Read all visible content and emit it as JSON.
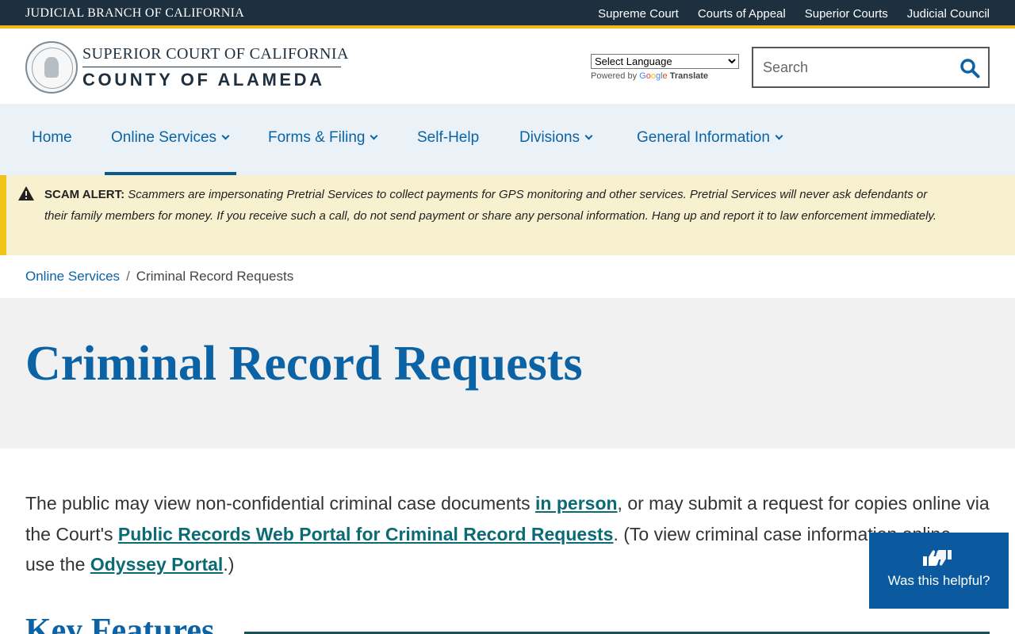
{
  "topbar": {
    "branch": "JUDICIAL BRANCH OF CALIFORNIA",
    "links": [
      "Supreme Court",
      "Courts of Appeal",
      "Superior Courts",
      "Judicial Council"
    ]
  },
  "header": {
    "court_line1": "SUPERIOR COURT OF CALIFORNIA",
    "court_line2": "COUNTY OF ALAMEDA",
    "language_select": "Select Language",
    "powered_by": "Powered by",
    "google": [
      "G",
      "o",
      "o",
      "g",
      "l",
      "e"
    ],
    "translate": "Translate",
    "search_placeholder": "Search"
  },
  "nav": {
    "items": [
      {
        "label": "Home"
      },
      {
        "label": "Online Services"
      },
      {
        "label": "Forms & Filing"
      },
      {
        "label": "Self-Help"
      },
      {
        "label": "Divisions"
      },
      {
        "label": "General Information"
      }
    ],
    "active": "Online Services"
  },
  "alert": {
    "label": "SCAM ALERT:",
    "text": "Scammers are impersonating Pretrial Services to collect payments for GPS monitoring and other services.  Pretrial Services will never ask defendants or their family members for money. If you receive such a call, do not send payment or share any personal information.  Hang up and report it to law enforcement immediately."
  },
  "breadcrumb": {
    "parent": "Online Services",
    "separator": "/",
    "current": "Criminal Record Requests"
  },
  "page": {
    "title": "Criminal Record Requests",
    "intro_1": "The public may view non-confidential criminal case documents ",
    "link_in_person": "in person",
    "intro_2": ", or may submit a request for copies online via the Court's ",
    "link_portal": "Public Records Web Portal for Criminal Record Requests",
    "intro_3": ". (To view criminal case information online, use the ",
    "link_odyssey": "Odyssey Portal",
    "intro_4": ".)",
    "section_heading": "Key Features"
  },
  "helpful": {
    "label": "Was this helpful?"
  },
  "colors": {
    "topbar": "#1e2f40",
    "accent_gold": "#f2b51a",
    "link_blue": "#0b63a5",
    "nav_bg": "#eaf2f8",
    "alert_bg": "#f8f1cf",
    "helpful_bg": "#0b5a9f"
  }
}
